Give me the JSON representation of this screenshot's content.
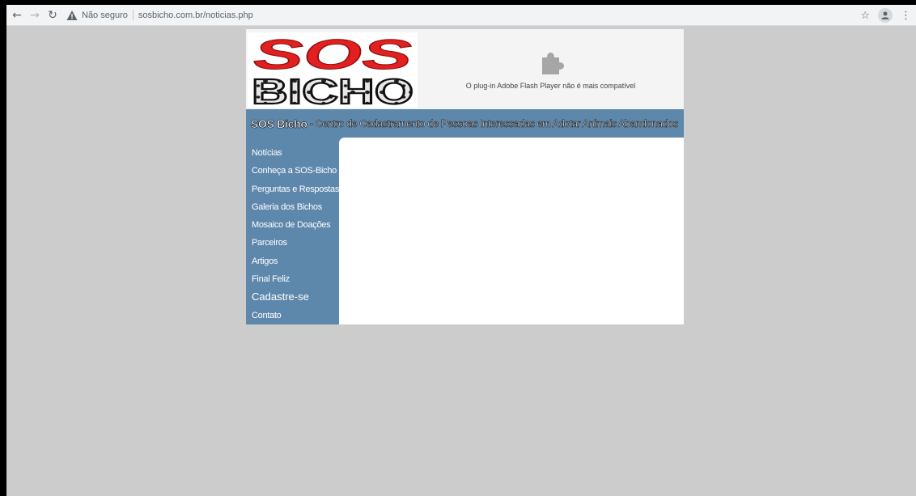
{
  "browser": {
    "security_label": "Não seguro",
    "url": "sosbicho.com.br/noticias.php"
  },
  "logo": {
    "line1": "SOS",
    "line2": "BICHO"
  },
  "flash": {
    "message": "O plug-in Adobe Flash Player não é mais compatível"
  },
  "banner": {
    "brand": "SOS Bicho",
    "tagline": "- Centro de Cadastramento de Pessoas Interessadas em Adotar Animais Abandonados"
  },
  "menu": {
    "items": [
      {
        "label": "Notícias"
      },
      {
        "label": "Conheça a SOS-Bicho"
      },
      {
        "label": "Perguntas e Respostas"
      },
      {
        "label": "Galeria dos Bichos"
      },
      {
        "label": "Mosaico de Doações"
      },
      {
        "label": "Parceiros"
      },
      {
        "label": "Artigos"
      },
      {
        "label": "Final Feliz"
      },
      {
        "label": "Cadastre-se"
      },
      {
        "label": "Contato"
      }
    ]
  },
  "colors": {
    "page_bg": "#cccccc",
    "nav_blue": "#5e87ac",
    "logo_red": "#e1201f"
  },
  "icons": {
    "back": "arrow-left-icon",
    "forward": "arrow-right-icon",
    "reload": "reload-icon",
    "warning": "warning-icon",
    "bookmark": "star-icon",
    "profile": "profile-icon",
    "menu": "kebab-menu-icon",
    "plugin": "puzzle-icon"
  }
}
